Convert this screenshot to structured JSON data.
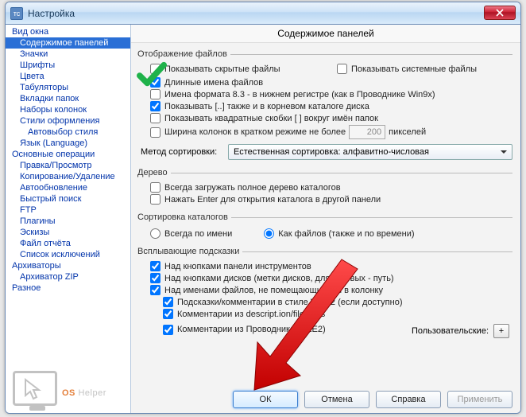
{
  "window": {
    "title": "Настройка"
  },
  "close_label": "✕",
  "sidebar": {
    "items": [
      {
        "label": "Вид окна",
        "indent": 0,
        "sel": false
      },
      {
        "label": "Содержимое панелей",
        "indent": 1,
        "sel": true
      },
      {
        "label": "Значки",
        "indent": 1,
        "sel": false
      },
      {
        "label": "Шрифты",
        "indent": 1,
        "sel": false
      },
      {
        "label": "Цвета",
        "indent": 1,
        "sel": false
      },
      {
        "label": "Табуляторы",
        "indent": 1,
        "sel": false
      },
      {
        "label": "Вкладки папок",
        "indent": 1,
        "sel": false
      },
      {
        "label": "Наборы колонок",
        "indent": 1,
        "sel": false
      },
      {
        "label": "Стили оформления",
        "indent": 1,
        "sel": false
      },
      {
        "label": "Автовыбор стиля",
        "indent": 2,
        "sel": false
      },
      {
        "label": "Язык (Language)",
        "indent": 1,
        "sel": false
      },
      {
        "label": "Основные операции",
        "indent": 0,
        "sel": false
      },
      {
        "label": "Правка/Просмотр",
        "indent": 1,
        "sel": false
      },
      {
        "label": "Копирование/Удаление",
        "indent": 1,
        "sel": false
      },
      {
        "label": "Автообновление",
        "indent": 1,
        "sel": false
      },
      {
        "label": "Быстрый поиск",
        "indent": 1,
        "sel": false
      },
      {
        "label": "FTP",
        "indent": 1,
        "sel": false
      },
      {
        "label": "Плагины",
        "indent": 1,
        "sel": false
      },
      {
        "label": "Эскизы",
        "indent": 1,
        "sel": false
      },
      {
        "label": "Файл отчёта",
        "indent": 1,
        "sel": false
      },
      {
        "label": "Список исключений",
        "indent": 1,
        "sel": false
      },
      {
        "label": "Архиваторы",
        "indent": 0,
        "sel": false
      },
      {
        "label": "Архиватор ZIP",
        "indent": 1,
        "sel": false
      },
      {
        "label": "Разное",
        "indent": 0,
        "sel": false
      }
    ]
  },
  "pane_title": "Содержимое панелей",
  "groups": {
    "display": {
      "legend": "Отображение файлов",
      "show_hidden": "Показывать скрытые файлы",
      "show_system": "Показывать системные файлы",
      "long_names": "Длинные имена файлов",
      "names83": "Имена формата 8.3 - в нижнем регистре (как в Проводнике Win9x)",
      "show_dotdot": "Показывать [..] также и в корневом каталоге диска",
      "square_brackets": "Показывать квадратные скобки [ ] вокруг имён папок",
      "col_width_pre": "Ширина колонок в кратком режиме не более",
      "col_width_val": "200",
      "col_width_post": "пикселей",
      "sort_method_label": "Метод сортировки:",
      "sort_method_value": "Естественная сортировка: алфавитно-числовая"
    },
    "tree": {
      "legend": "Дерево",
      "full_tree": "Всегда загружать полное дерево каталогов",
      "enter_open": "Нажать Enter для открытия каталога в другой панели"
    },
    "sortdirs": {
      "legend": "Сортировка каталогов",
      "by_name": "Всегда по имени",
      "like_files": "Как файлов (также и по времени)"
    },
    "tooltips": {
      "legend": "Всплывающие подсказки",
      "over_toolbar": "Над кнопками панели инструментов",
      "over_drives": "Над кнопками дисков (метки дисков, для сетевых - путь)",
      "over_names": "Над именами файлов, не помещающимися в колонку",
      "win32_style": "Подсказки/комментарии в стиле Win32 (если доступно)",
      "descript_ion": "Комментарии из descript.ion/files.bbs",
      "explorer_ole2": "Комментарии из Проводника (OLE2)",
      "custom_label": "Пользовательские:",
      "plus": "+"
    }
  },
  "buttons": {
    "ok": "ОК",
    "cancel": "Отмена",
    "help": "Справка",
    "apply": "Применить"
  },
  "watermark": {
    "os": "OS",
    "rest": " Helper"
  }
}
